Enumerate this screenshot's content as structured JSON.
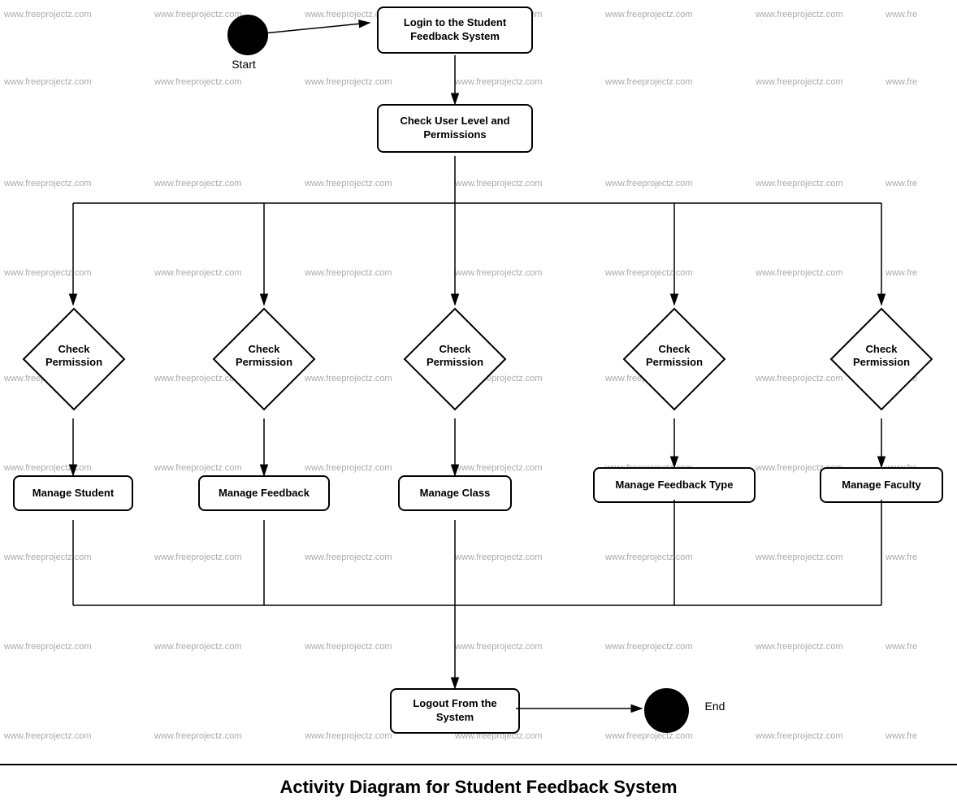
{
  "diagram": {
    "title": "Activity Diagram for Student Feedback System",
    "watermark": "www.freeprojectz.com",
    "nodes": {
      "start_label": "Start",
      "login": "Login to the Student Feedback System",
      "check_permissions": "Check User Level and Permissions",
      "check_perm1": "Check\nPermission",
      "check_perm2": "Check\nPermission",
      "check_perm3": "Check\nPermission",
      "check_perm4": "Check\nPermission",
      "check_perm5": "Check\nPermission",
      "manage_student": "Manage Student",
      "manage_feedback": "Manage Feedback",
      "manage_class": "Manage Class",
      "manage_feedback_type": "Manage Feedback Type",
      "manage_faculty": "Manage Faculty",
      "logout": "Logout From the System",
      "end_label": "End"
    }
  }
}
